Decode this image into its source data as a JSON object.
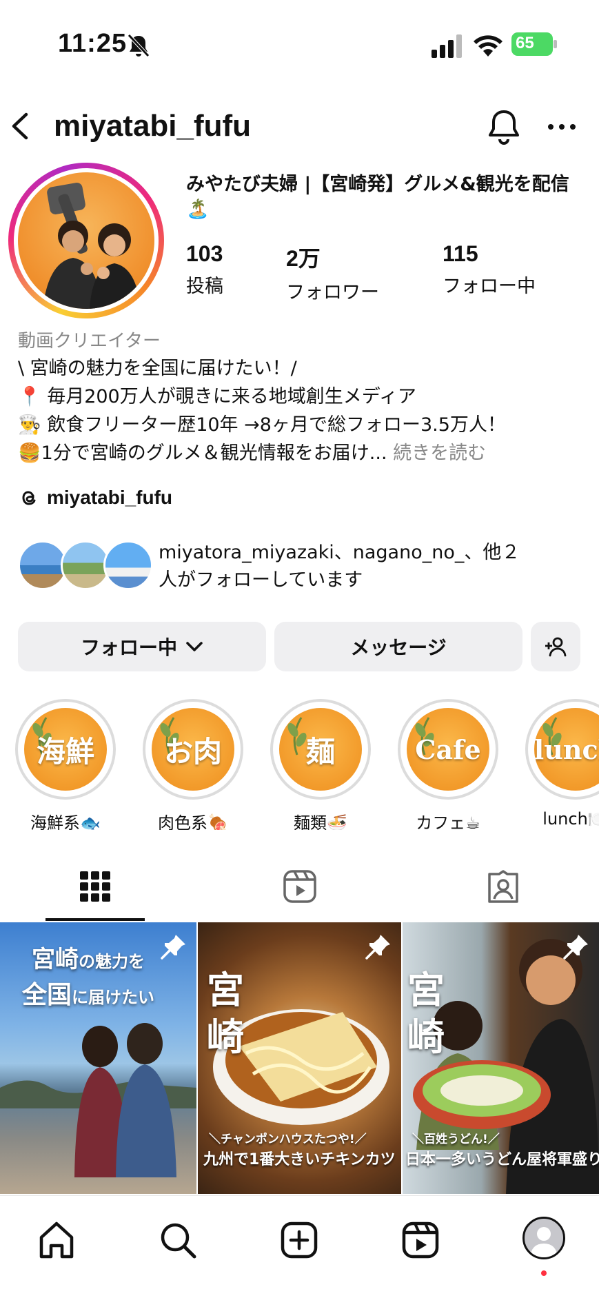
{
  "status_bar": {
    "time": "11:25",
    "battery": "65",
    "icons": [
      "bell-slash-icon",
      "cellular-signal-icon",
      "wifi-icon",
      "battery-icon"
    ]
  },
  "header": {
    "username": "miyatabi_fufu",
    "icons": [
      "back-arrow-icon",
      "bell-icon",
      "more-icon"
    ]
  },
  "profile": {
    "display_name": "みやたび夫婦 |【宮崎発】グルメ&観光を配信🏝️",
    "stats": [
      {
        "value": "103",
        "label": "投稿"
      },
      {
        "value": "2万",
        "label": "フォロワー"
      },
      {
        "value": "115",
        "label": "フォロー中"
      }
    ],
    "category": "動画クリエイター",
    "bio_lines": [
      "\\ 宮崎の魅力を全国に届けたい！/",
      "📍 毎月200万人が覗きに来る地域創生メディア",
      "👨‍🍳 飲食フリーター歴10年 →8ヶ月で総フォロー3.5万人！",
      "🍔1分で宮崎のグルメ＆観光情報をお届け..."
    ],
    "read_more": "続きを読む",
    "threads_handle": "miyatabi_fufu",
    "followed_by_line1": "miyatora_miyazaki、nagano_no_、他２",
    "followed_by_line2": "人がフォローしています"
  },
  "actions": {
    "following": "フォロー中",
    "message": "メッセージ"
  },
  "highlights": [
    {
      "cover": "海鮮",
      "label": "海鮮系🐟"
    },
    {
      "cover": "お肉",
      "label": "肉色系🍖"
    },
    {
      "cover": "麺",
      "label": "麺類🍜"
    },
    {
      "cover": "Cafe",
      "label": "カフェ☕"
    },
    {
      "cover": "lunch",
      "label": "lunch🍽️"
    }
  ],
  "tabs": [
    "grid-icon",
    "reels-icon",
    "tagged-icon"
  ],
  "posts": [
    {
      "title_line1_big": "宮崎",
      "title_line1_small": "の魅力を",
      "title_line2_big": "全国",
      "title_line2_small": "に届けたい"
    },
    {
      "vertical": "宮崎",
      "subcaption": "＼チャンポンハウスたつや!／",
      "caption": "九州で1番大きいチキンカツ"
    },
    {
      "vertical": "宮崎",
      "subcaption": "＼百姓うどん!／",
      "caption": "日本一多いうどん屋将軍盛り"
    }
  ],
  "bottom_nav": [
    "home-icon",
    "search-icon",
    "create-icon",
    "reels-icon",
    "profile-avatar"
  ],
  "colors": {
    "button_bg": "#efeff1",
    "highlight_orange": "#f29a2a",
    "notification_dot": "#ff3040"
  }
}
